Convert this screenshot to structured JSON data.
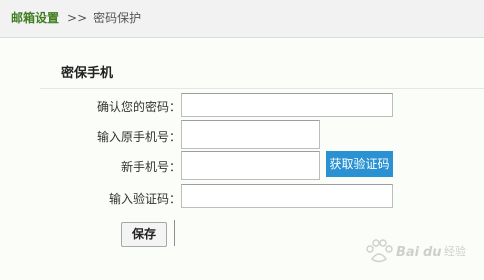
{
  "breadcrumb": {
    "root": "邮箱设置",
    "separator": ">>",
    "current": "密码保护"
  },
  "section": {
    "title": "密保手机"
  },
  "form": {
    "confirm_password_label": "确认您的密码：",
    "confirm_password_value": "",
    "original_phone_label": "输入原手机号：",
    "original_phone_value": "",
    "new_phone_label": "新手机号：",
    "new_phone_value": "",
    "get_code_label": "获取验证码",
    "code_label": "输入验证码：",
    "code_value": "",
    "save_label": "保存"
  },
  "watermark": {
    "text": "Baidu 经验"
  },
  "colors": {
    "breadcrumb_root": "#3f7d20",
    "code_button": "#2a92d2",
    "panel_background": "#fbfdf8"
  }
}
